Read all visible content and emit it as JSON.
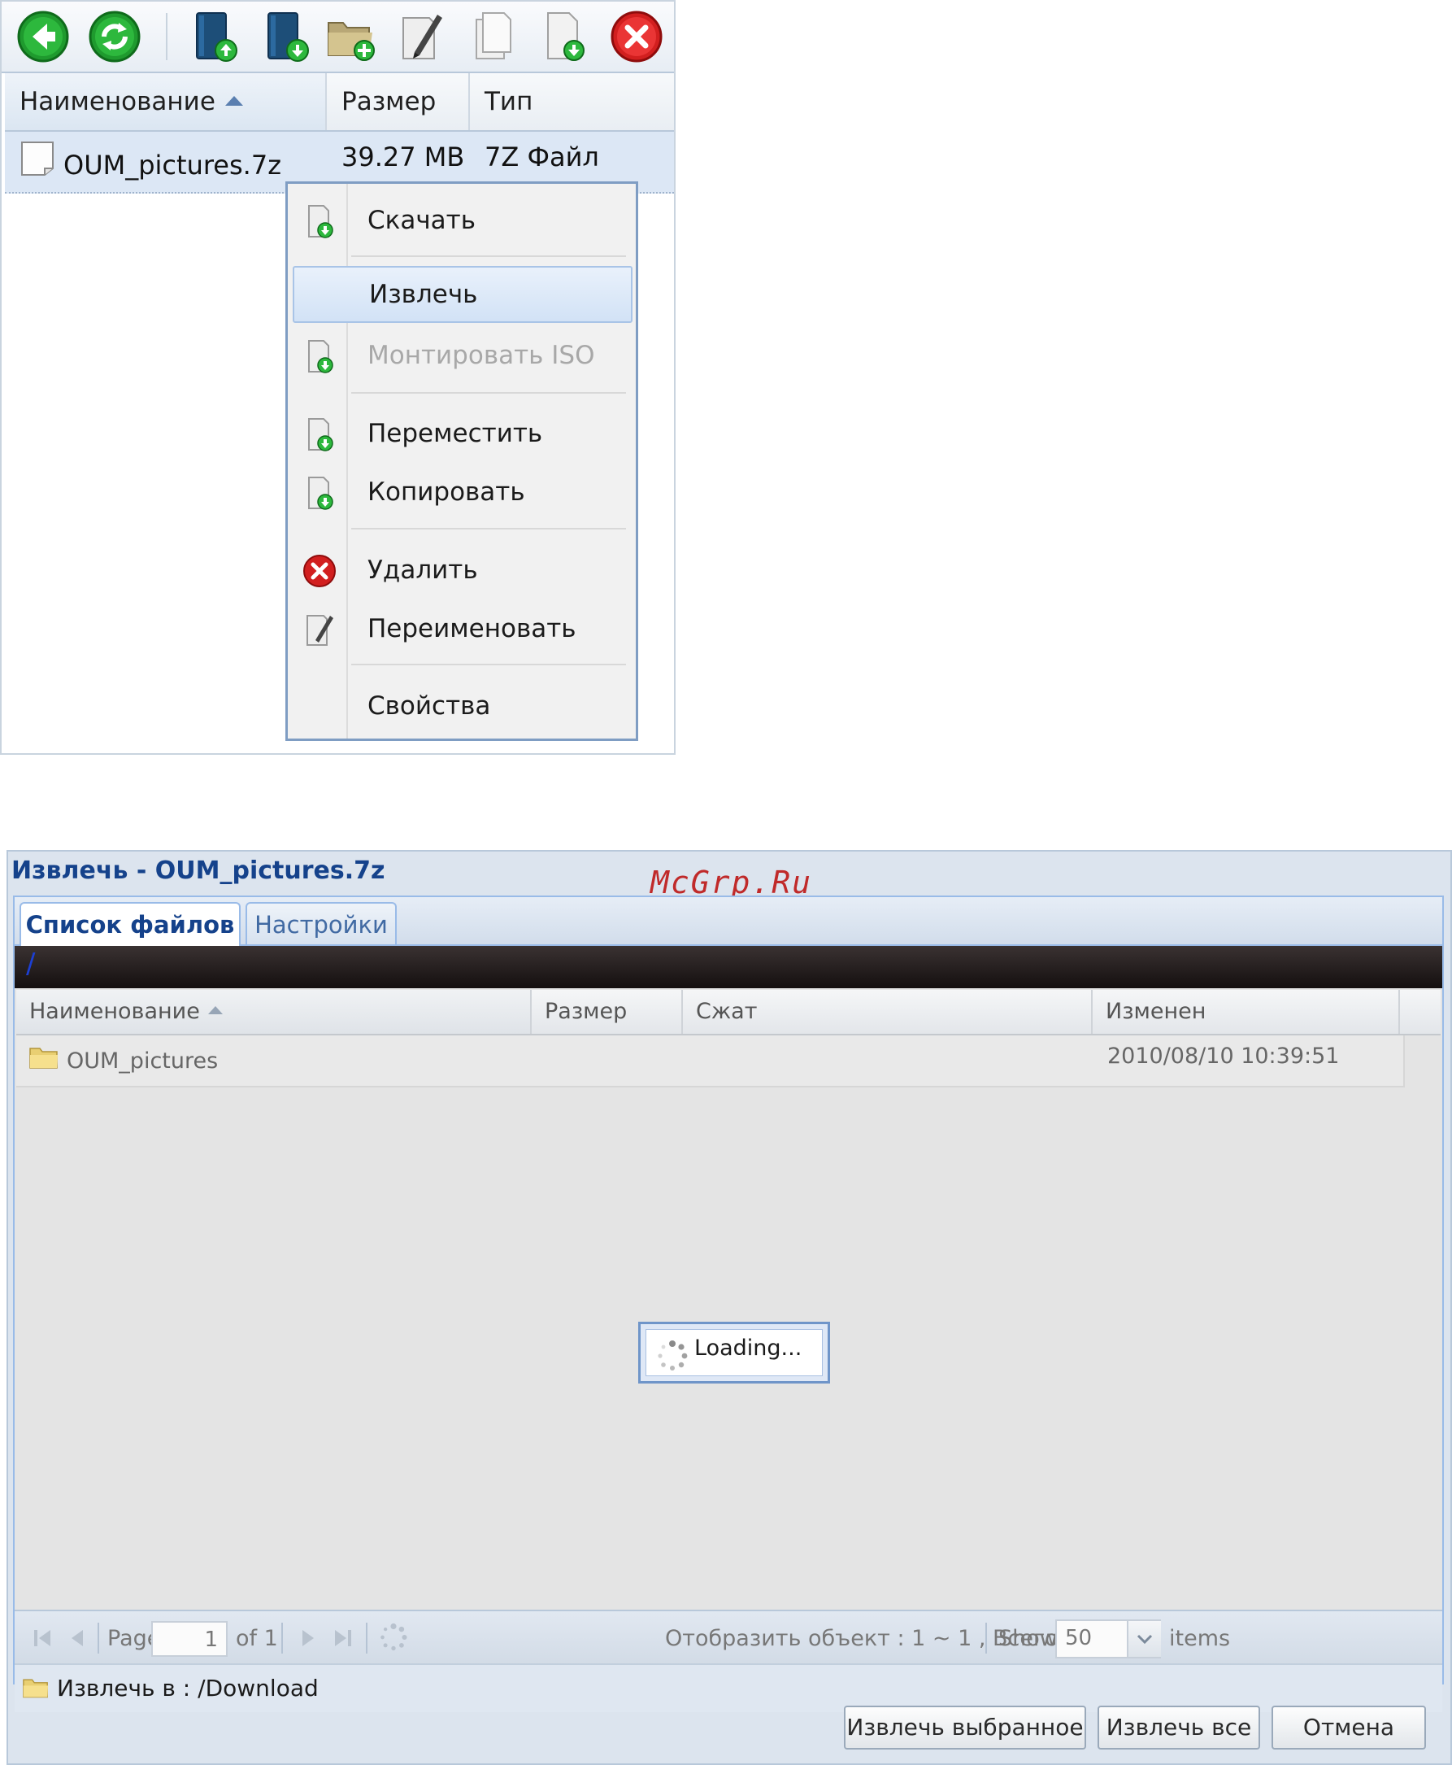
{
  "file_manager": {
    "toolbar": {
      "buttons": [
        "back",
        "refresh",
        "upload",
        "download",
        "new-folder",
        "rename",
        "copy",
        "extract",
        "delete"
      ]
    },
    "columns": {
      "name": "Наименование",
      "size": "Размер",
      "type": "Тип"
    },
    "rows": [
      {
        "name": "OUM_pictures.7z",
        "size": "39.27 MB",
        "type": "7Z Файл"
      }
    ],
    "context_menu": {
      "items": [
        {
          "label": "Скачать",
          "icon": "download-file-icon",
          "state": "normal"
        },
        {
          "label": "Извлечь",
          "icon": "",
          "state": "hover"
        },
        {
          "label": "Монтировать ISO",
          "icon": "mount-iso-icon",
          "state": "disabled"
        },
        {
          "label": "Переместить",
          "icon": "move-file-icon",
          "state": "normal"
        },
        {
          "label": "Копировать",
          "icon": "copy-file-icon",
          "state": "normal"
        },
        {
          "label": "Удалить",
          "icon": "delete-icon",
          "state": "normal"
        },
        {
          "label": "Переименовать",
          "icon": "rename-icon",
          "state": "normal"
        },
        {
          "label": "Свойства",
          "icon": "",
          "state": "normal"
        }
      ]
    }
  },
  "extract_dialog": {
    "title": "Извлечь - OUM_pictures.7z",
    "watermark": "McGrp.Ru",
    "tabs": [
      {
        "label": "Список файлов",
        "active": true
      },
      {
        "label": "Настройки",
        "active": false
      }
    ],
    "path": "/",
    "columns": {
      "name": "Наименование",
      "size": "Размер",
      "compressed": "Сжат",
      "modified": "Изменен"
    },
    "rows": [
      {
        "name": "OUM_pictures",
        "size": "",
        "compressed": "",
        "modified": "2010/08/10 10:39:51"
      }
    ],
    "loading_text": "Loading...",
    "pager": {
      "page_label": "Page",
      "page_value": "1",
      "of_label": "of 1",
      "summary": "Отобразить объект : 1 ~ 1 , Всего : 1",
      "show_label": "Show",
      "show_value": "50",
      "items_label": "items"
    },
    "extract_to": "Извлечь в : /Download",
    "buttons": {
      "extract_selected": "Извлечь выбранное",
      "extract_all": "Извлечь все",
      "cancel": "Отмена"
    },
    "colors": {
      "title": "#15428b",
      "watermark": "#c02a2a",
      "accent_border": "#99bbe8"
    }
  }
}
